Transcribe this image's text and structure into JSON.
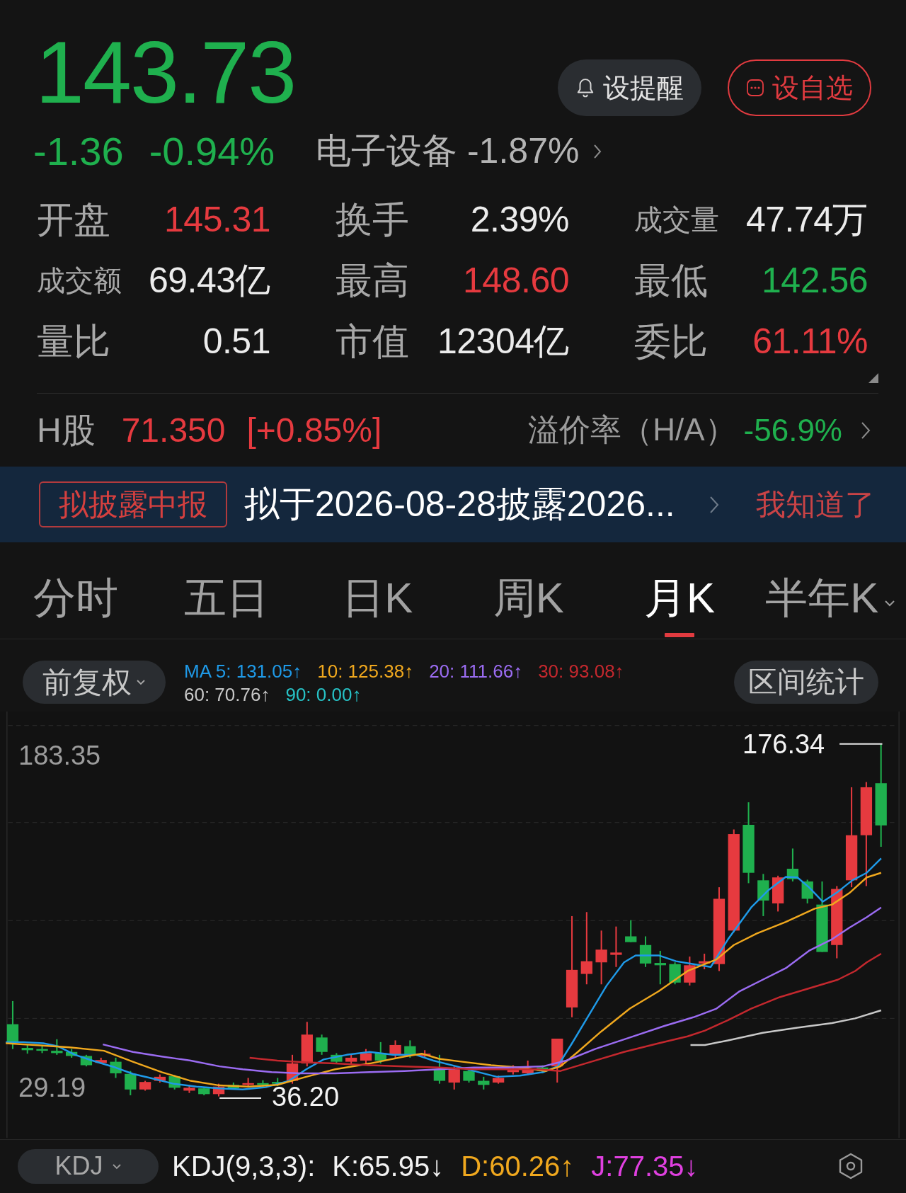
{
  "quote": {
    "price": "143.73",
    "color": "#1fb04e",
    "change": "-1.36",
    "change_percent": "-0.94%",
    "sector": "电子设备 -1.87%"
  },
  "actions": [
    {
      "label": "设提醒",
      "kind": "alert"
    },
    {
      "label": "设自选",
      "kind": "watchlist"
    }
  ],
  "stats": [
    {
      "label": "开盘",
      "value": "145.31",
      "color": "#e63a3f",
      "kind": "normal"
    },
    {
      "label": "换手",
      "value": "2.39%",
      "color": "#ececec",
      "kind": "normal"
    },
    {
      "label": "成交量",
      "value": "47.74万",
      "color": "#ececec",
      "kind": "compact"
    },
    {
      "label": "成交额",
      "value": "69.43亿",
      "color": "#ececec",
      "kind": "compact"
    },
    {
      "label": "最高",
      "value": "148.60",
      "color": "#e63a3f",
      "kind": "normal"
    },
    {
      "label": "最低",
      "value": "142.56",
      "color": "#1fb04e",
      "kind": "normal"
    },
    {
      "label": "量比",
      "value": "0.51",
      "color": "#ececec",
      "kind": "normal"
    },
    {
      "label": "市值",
      "value": "12304亿",
      "color": "#ececec",
      "kind": "normal"
    },
    {
      "label": "委比",
      "value": "61.11%",
      "color": "#e63a3f",
      "kind": "normal"
    }
  ],
  "h_share": {
    "label": "H股",
    "price": "71.350",
    "change": "[+0.85%]",
    "color": "#e63a3f",
    "premium": {
      "label": "溢价率（H/A）",
      "value": "-56.9%",
      "color": "#1fb04e"
    }
  },
  "notice": {
    "tag": "拟披露中报",
    "message": "拟于2026-08-28披露2026...",
    "dismiss": "我知道了"
  },
  "tabs": [
    {
      "label": "分时",
      "selected": false,
      "dropdown": false
    },
    {
      "label": "五日",
      "selected": false,
      "dropdown": false
    },
    {
      "label": "日K",
      "selected": false,
      "dropdown": false
    },
    {
      "label": "周K",
      "selected": false,
      "dropdown": false
    },
    {
      "label": "月K",
      "selected": true,
      "dropdown": false
    },
    {
      "label": "半年K",
      "selected": false,
      "dropdown": true
    }
  ],
  "chart": {
    "adjustment": "前复权",
    "moving_averages": [
      {
        "label": "MA 5: 131.05↑",
        "color": "#1f9ae8"
      },
      {
        "label": "10: 125.38↑",
        "color": "#f0a81e"
      },
      {
        "label": "20: 111.66↑",
        "color": "#9b6cf2"
      },
      {
        "label": "30: 93.08↑",
        "color": "#c4282e"
      },
      {
        "label": "60: 70.76↑",
        "color": "#c8c8c8"
      },
      {
        "label": "90: 0.00↑",
        "color": "#27c2c6"
      }
    ],
    "range_button": "区间统计",
    "axis_max": "183.35",
    "axis_min": "29.19",
    "high_label": "176.34",
    "low_label": "36.20"
  },
  "indicator": {
    "selector": "KDJ",
    "params": "KDJ(9,3,3):",
    "values": [
      {
        "label": "K:65.95↓",
        "color": "#f2f2f2"
      },
      {
        "label": "D:60.26↑",
        "color": "#f0a81e"
      },
      {
        "label": "J:77.35↓",
        "color": "#e040e0"
      }
    ]
  }
}
